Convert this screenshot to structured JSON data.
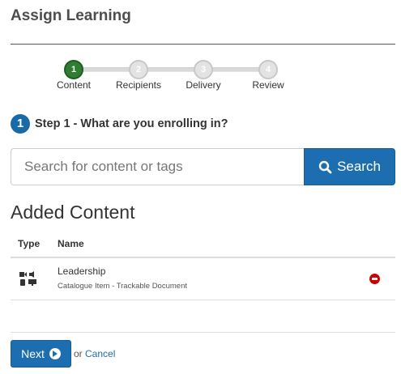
{
  "page": {
    "title": "Assign Learning"
  },
  "stepper": {
    "steps": [
      {
        "number": "1",
        "label": "Content",
        "active": true
      },
      {
        "number": "2",
        "label": "Recipients",
        "active": false
      },
      {
        "number": "3",
        "label": "Delivery",
        "active": false
      },
      {
        "number": "4",
        "label": "Review",
        "active": false
      }
    ]
  },
  "step_heading": {
    "badge": "1",
    "title": "Step 1 - What are you enrolling in?"
  },
  "search": {
    "placeholder": "Search for content or tags",
    "value": "",
    "button_label": "Search"
  },
  "added_content": {
    "title": "Added Content",
    "columns": [
      "Type",
      "Name"
    ],
    "rows": [
      {
        "type_icon": "trackable-document-icon",
        "name": "Leadership",
        "detail": "Catalogue Item - Trackable Document"
      }
    ]
  },
  "footer": {
    "next_label": "Next",
    "or_text": "or",
    "cancel_label": "Cancel"
  },
  "colors": {
    "primary": "#1d6eb0",
    "active_step": "#2e7d32",
    "remove": "#cc0000"
  }
}
